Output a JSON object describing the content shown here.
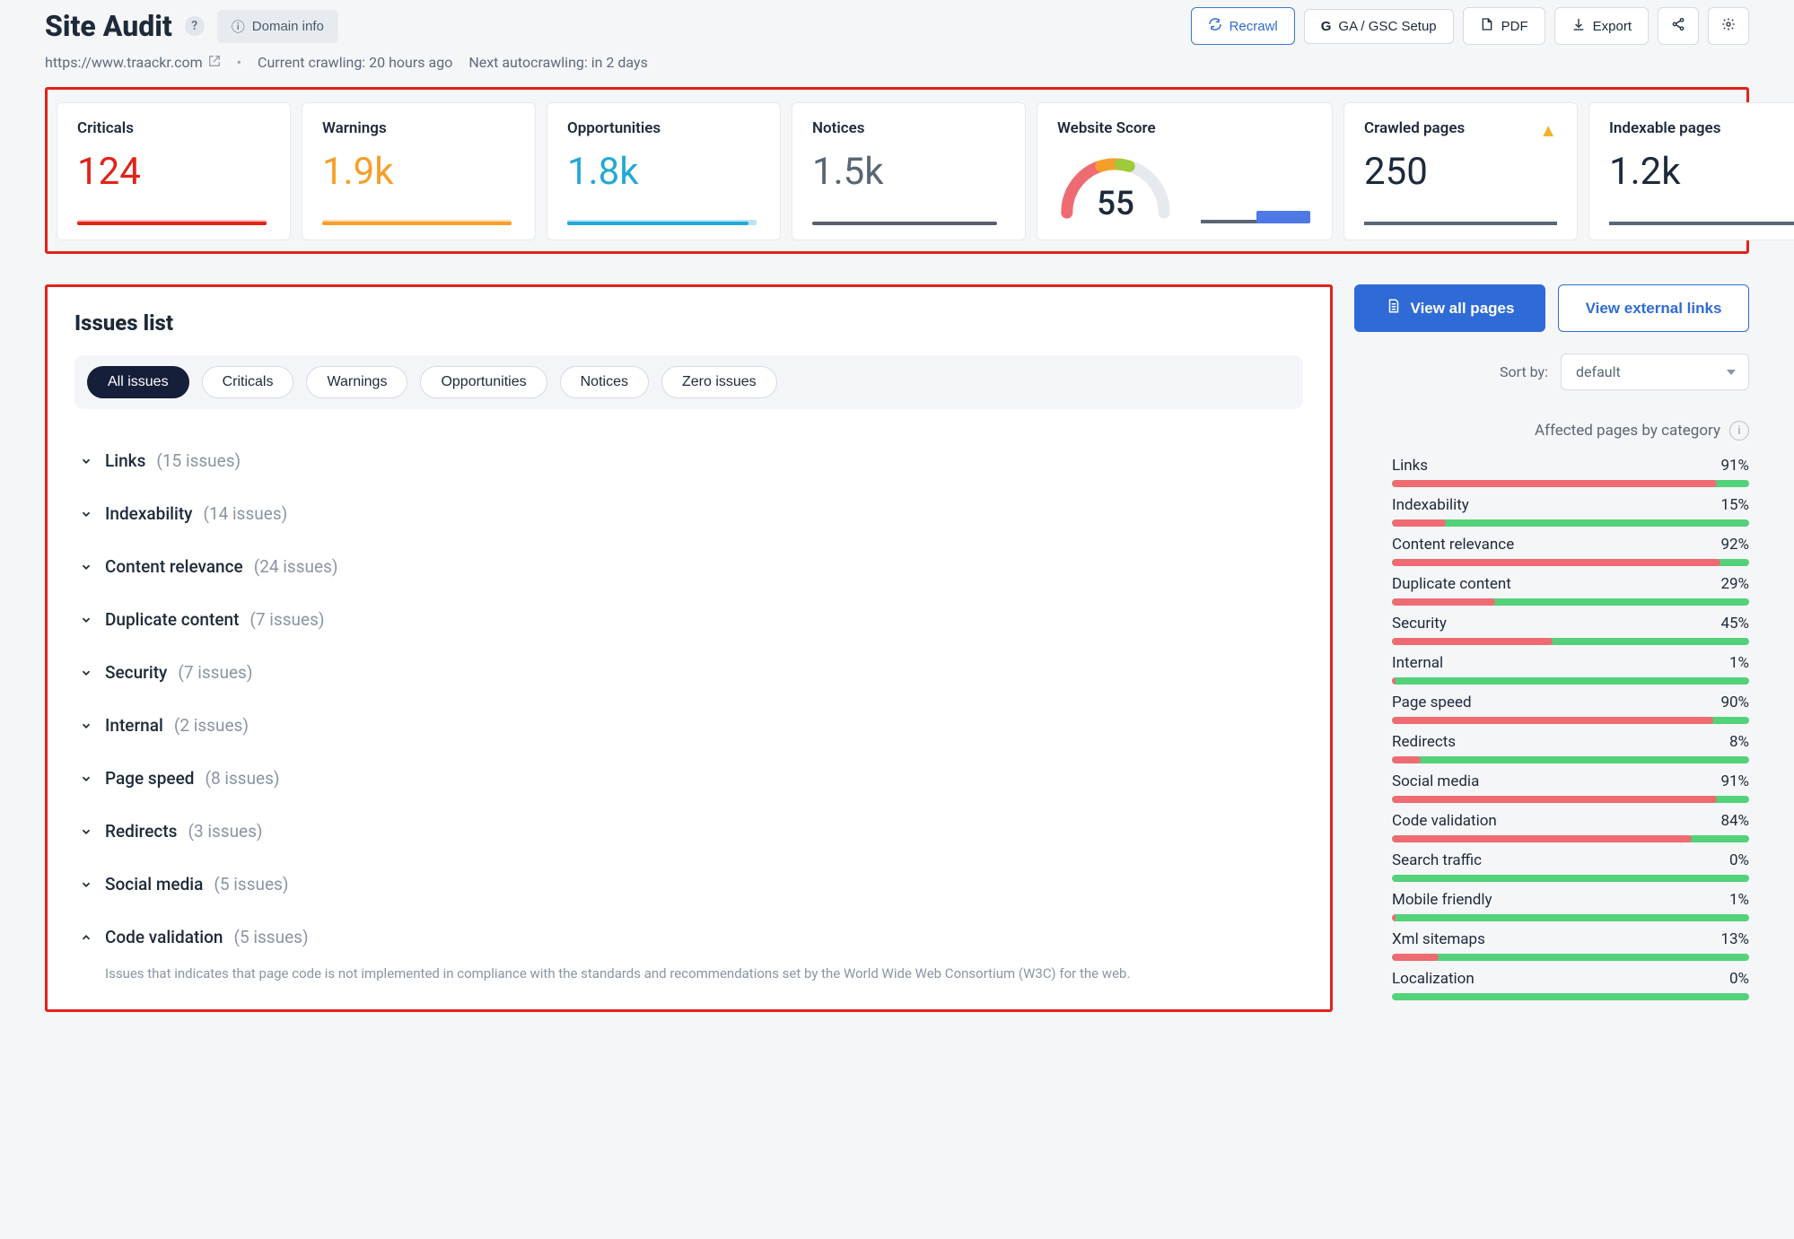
{
  "header": {
    "title": "Site Audit",
    "domain_info_label": "Domain info",
    "buttons": {
      "recrawl": "Recrawl",
      "ga_gsc": "GA / GSC Setup",
      "pdf": "PDF",
      "export": "Export"
    }
  },
  "subheader": {
    "domain": "https://www.traackr.com",
    "current_crawl": "Current crawling: 20 hours ago",
    "next_crawl": "Next autocrawling: in 2 days"
  },
  "stats": {
    "criticals": {
      "label": "Criticals",
      "value": "124"
    },
    "warnings": {
      "label": "Warnings",
      "value": "1.9k"
    },
    "opps": {
      "label": "Opportunities",
      "value": "1.8k"
    },
    "notices": {
      "label": "Notices",
      "value": "1.5k"
    },
    "score": {
      "label": "Website Score",
      "value": "55"
    },
    "crawled": {
      "label": "Crawled pages",
      "value": "250"
    },
    "indexable": {
      "label": "Indexable pages",
      "value": "1.2k"
    }
  },
  "issues": {
    "title": "Issues list",
    "filters": {
      "all": "All issues",
      "criticals": "Criticals",
      "warnings": "Warnings",
      "opportunities": "Opportunities",
      "notices": "Notices",
      "zero": "Zero issues"
    },
    "categories": [
      {
        "name": "Links",
        "count": "(15 issues)",
        "expanded": false
      },
      {
        "name": "Indexability",
        "count": "(14 issues)",
        "expanded": false
      },
      {
        "name": "Content relevance",
        "count": "(24 issues)",
        "expanded": false
      },
      {
        "name": "Duplicate content",
        "count": "(7 issues)",
        "expanded": false
      },
      {
        "name": "Security",
        "count": "(7 issues)",
        "expanded": false
      },
      {
        "name": "Internal",
        "count": "(2 issues)",
        "expanded": false
      },
      {
        "name": "Page speed",
        "count": "(8 issues)",
        "expanded": false
      },
      {
        "name": "Redirects",
        "count": "(3 issues)",
        "expanded": false
      },
      {
        "name": "Social media",
        "count": "(5 issues)",
        "expanded": false
      },
      {
        "name": "Code validation",
        "count": "(5 issues)",
        "expanded": true
      }
    ],
    "code_validation_desc": "Issues that indicates that page code is not implemented in compliance with the standards and recommendations set by the World Wide Web Consortium (W3C) for the web."
  },
  "right": {
    "view_all_pages": "View all pages",
    "view_external": "View external links",
    "sort_label": "Sort by:",
    "sort_value": "default",
    "affected_title": "Affected pages by category",
    "affected": [
      {
        "name": "Links",
        "pct": "91%",
        "red": 91
      },
      {
        "name": "Indexability",
        "pct": "15%",
        "red": 15
      },
      {
        "name": "Content relevance",
        "pct": "92%",
        "red": 92
      },
      {
        "name": "Duplicate content",
        "pct": "29%",
        "red": 29
      },
      {
        "name": "Security",
        "pct": "45%",
        "red": 45
      },
      {
        "name": "Internal",
        "pct": "1%",
        "red": 1
      },
      {
        "name": "Page speed",
        "pct": "90%",
        "red": 90
      },
      {
        "name": "Redirects",
        "pct": "8%",
        "red": 8
      },
      {
        "name": "Social media",
        "pct": "91%",
        "red": 91
      },
      {
        "name": "Code validation",
        "pct": "84%",
        "red": 84
      },
      {
        "name": "Search traffic",
        "pct": "0%",
        "red": 0
      },
      {
        "name": "Mobile friendly",
        "pct": "1%",
        "red": 1
      },
      {
        "name": "Xml sitemaps",
        "pct": "13%",
        "red": 13
      },
      {
        "name": "Localization",
        "pct": "0%",
        "red": 0
      }
    ]
  }
}
